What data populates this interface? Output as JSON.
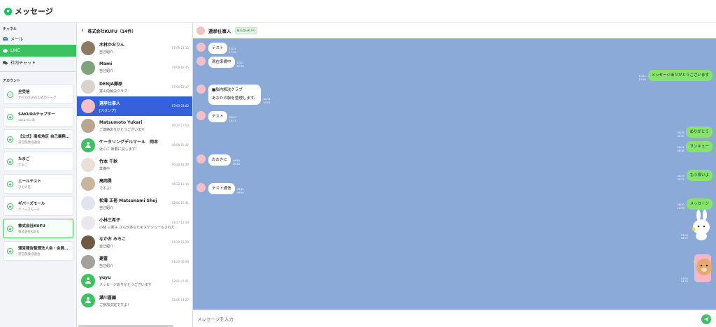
{
  "app": {
    "title": "メッセージ"
  },
  "sidebar": {
    "channel_label": "チャネル",
    "channels": [
      {
        "label": "メール",
        "icon": "mail-icon",
        "active": false
      },
      {
        "label": "LINE",
        "icon": "line-icon",
        "active": true
      },
      {
        "label": "社内チャット",
        "icon": "chat-icon",
        "active": false
      }
    ],
    "account_label": "アカウント",
    "accounts": [
      {
        "name": "全受信",
        "desc": "すべてのLINE公式のトーク",
        "icon": "inbox-icon",
        "active": false
      },
      {
        "name": "SAKURAチャプター",
        "desc": "sakuraにあ",
        "icon": "line-icon",
        "active": false
      },
      {
        "name": "【公式】南松地区 自己業務…",
        "desc": "運営開発協議会",
        "icon": "line-icon",
        "active": false
      },
      {
        "name": "たまご",
        "desc": "たまご",
        "icon": "line-icon",
        "active": false
      },
      {
        "name": "エールテスト",
        "desc": "ひだの先",
        "icon": "line-icon",
        "active": false
      },
      {
        "name": "ギバーズモール",
        "desc": "ギバーズモール",
        "icon": "line-icon",
        "active": false
      },
      {
        "name": "株式会社KUFU",
        "desc": "株式会社KUFU",
        "icon": "line-icon",
        "active": true
      },
      {
        "name": "運営報告整理法人会・会員…",
        "desc": "運営開発協議会",
        "icon": "line-icon",
        "active": false
      }
    ]
  },
  "chatlist": {
    "header": "株式会社KUFU（14件）",
    "items": [
      {
        "name": "木林かおりん",
        "msg": "自己紹介",
        "time": "07/09 23:13",
        "avatar": "photo",
        "color": "#8d7a64",
        "active": false
      },
      {
        "name": "Mami",
        "msg": "自己紹介",
        "time": "07/08 18:45",
        "avatar": "photo",
        "color": "#7fa37a",
        "active": false
      },
      {
        "name": "DENJA藤原",
        "msg": "富山内解決クラブ",
        "time": "07/04 12:37",
        "avatar": "photo",
        "color": "#d9d3cf",
        "active": false
      },
      {
        "name": "選挙仕事人",
        "msg": "[スタンプ]",
        "time": "07/03 23:02",
        "avatar": "photo",
        "color": "#f2c0c6",
        "active": true
      },
      {
        "name": "Matsumoto Yukari",
        "msg": "ご連絡ありがとうございます",
        "time": "06/27 17:03",
        "avatar": "photo",
        "color": "#b9a68e",
        "active": false
      },
      {
        "name": "ケータリングデルマール　岡本",
        "msg": "近くに 新着に戻します！",
        "time": "06/08 15:42",
        "avatar": "green",
        "color": "#3cc261",
        "active": false
      },
      {
        "name": "竹本 千秋",
        "msg": "準備中",
        "time": "06/23 18:49",
        "avatar": "photo",
        "color": "#e9e1d8",
        "active": false
      },
      {
        "name": "高岡勇",
        "msg": "ですよ！",
        "time": "06/22 13:19",
        "avatar": "photo",
        "color": "#c7b59c",
        "active": false
      },
      {
        "name": "松濤 正裕 Matsunami Shoj",
        "msg": "自己紹介",
        "time": "02/06 15:41",
        "avatar": "photo",
        "color": "#dfe4ee",
        "active": false
      },
      {
        "name": "小林三希子",
        "msg": "小林 三希子 さんがあなたをスケジュールされた Zoom",
        "time": "01/27 12:09",
        "avatar": "photo",
        "color": "#ebe5ee",
        "active": false
      },
      {
        "name": "なかお みちこ",
        "msg": "自己紹介",
        "time": "01/20 15:28",
        "avatar": "photo",
        "color": "#6d5a44",
        "active": false
      },
      {
        "name": "建富",
        "msg": "自己紹介",
        "time": "01/20 09:08",
        "avatar": "photo",
        "color": "#a3a19b",
        "active": false
      },
      {
        "name": "yuyu",
        "msg": "メッセージありがとうございます",
        "time": "12/01 07:01",
        "avatar": "green",
        "color": "#3cc261",
        "active": false
      },
      {
        "name": "瀬川喜願",
        "msg": "ご参加決定ですよ！",
        "time": "11/06 14:27",
        "avatar": "green",
        "color": "#3cc261",
        "active": false
      }
    ]
  },
  "chat": {
    "contact": "選挙仕事人",
    "badge": "株式会社KUFU",
    "messages": [
      {
        "side": "left",
        "lines": [
          "テスト"
        ],
        "meta": [
          "12/15",
          "17:18"
        ]
      },
      {
        "side": "left",
        "lines": [
          "現在準備中"
        ],
        "meta": [
          "12/21",
          "10:38"
        ]
      },
      {
        "side": "right",
        "lines": [
          "メッセージありがとうございます"
        ],
        "meta": [
          "12/21",
          "13:06"
        ]
      },
      {
        "side": "left",
        "lines": [
          "■脳内解決クラブ",
          "あなたの脳を整理します。"
        ],
        "meta": [
          "04/11",
          "20:07"
        ]
      },
      {
        "side": "left",
        "lines": [
          "テスト"
        ],
        "meta": [
          "05/10",
          "16:11"
        ]
      },
      {
        "side": "right",
        "lines": [
          "ありがとう"
        ],
        "meta": [
          "06/19",
          "06:30"
        ]
      },
      {
        "side": "right",
        "lines": [
          "サンキュー"
        ],
        "meta": [
          "06/19",
          "06:38"
        ]
      },
      {
        "side": "left",
        "lines": [
          "おおきに"
        ],
        "meta": [
          "06/19",
          "09:52"
        ]
      },
      {
        "side": "right",
        "lines": [
          "もう良いよ"
        ],
        "meta": [
          "06/19",
          "09:52"
        ]
      },
      {
        "side": "left",
        "lines": [
          "テスト通信"
        ],
        "meta": [
          "06/19",
          "09:56"
        ]
      },
      {
        "side": "right",
        "lines": [
          "メッセージ"
        ],
        "meta": [
          "06/20",
          "22:56"
        ]
      },
      {
        "side": "right",
        "sticker": "bunny-sticker-icon",
        "meta": [
          "07/03",
          "23:02"
        ]
      },
      {
        "side": "right",
        "sticker": "bear-sticker-icon",
        "meta": [
          "07/03",
          "23:02"
        ]
      }
    ],
    "composer_placeholder": "メッセージを入力"
  },
  "colors": {
    "line_green": "#3cc261",
    "selected_blue": "#3561dc",
    "chat_background": "#8caad8"
  }
}
